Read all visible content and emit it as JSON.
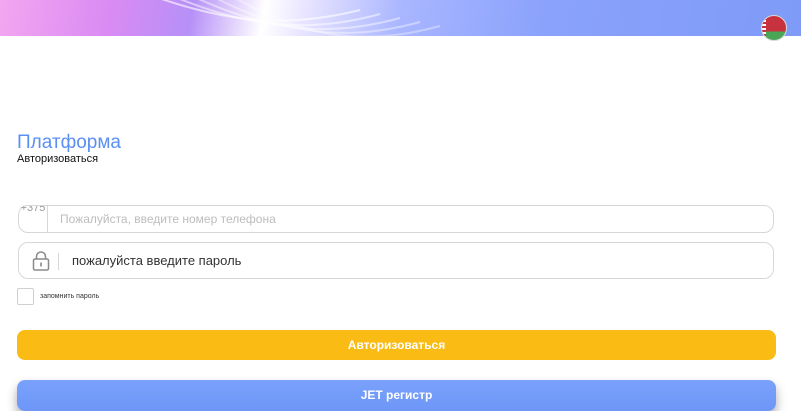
{
  "language": {
    "flag_icon": "belarus-flag-icon"
  },
  "header": {
    "title": "Платформа",
    "subtitle": "Авторизоваться"
  },
  "form": {
    "phone": {
      "prefix": "+375",
      "placeholder": "Пожалуйста, введите номер телефона",
      "value": ""
    },
    "password": {
      "icon": "lock-icon",
      "placeholder": "пожалуйста введите пароль",
      "value": ""
    },
    "remember": {
      "label": "запомнить пароль",
      "checked": false
    }
  },
  "buttons": {
    "login_label": "Авторизоваться",
    "register_label": "JET регистр"
  },
  "colors": {
    "accent": "#5b8ff2",
    "login_button": "#f9bb14",
    "register_button": "#6d96f7"
  }
}
